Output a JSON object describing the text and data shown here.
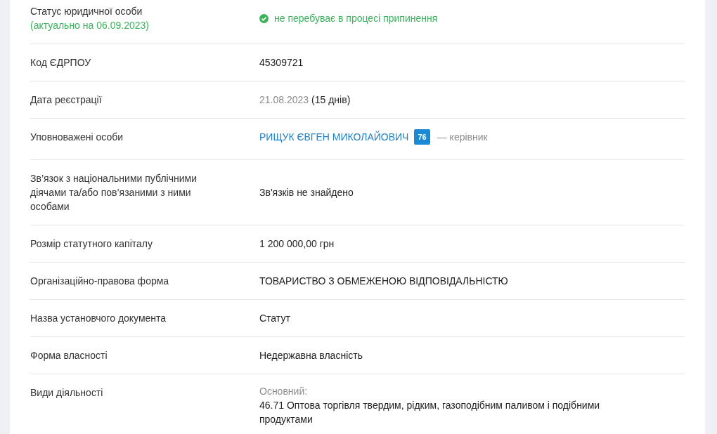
{
  "rows": [
    {
      "kind": "status",
      "label": "Статус юридичної особи",
      "note": "(актуально на 06.09.2023)",
      "value": "не перебуває в процесі припинення"
    },
    {
      "kind": "plain",
      "label": "Код ЄДРПОУ",
      "value": "45309721"
    },
    {
      "kind": "date",
      "label": "Дата реєстрації",
      "value": "21.08.2023",
      "suffix": "(15 днів)"
    },
    {
      "kind": "person",
      "label": "Уповноважені особи",
      "value": "РИЩУК ЄВГЕН МИКОЛАЙОВИЧ",
      "badge": "76",
      "role": "— керівник"
    },
    {
      "kind": "plain",
      "label": "Зв’язок з національними публічними діячами та/або пов’язаними з ними особами",
      "value": "Зв'язків не знайдено"
    },
    {
      "kind": "plain",
      "label": "Розмір статутного капіталу",
      "value": "1 200 000,00 грн"
    },
    {
      "kind": "plain",
      "label": "Організаційно-правова форма",
      "value": "ТОВАРИСТВО З ОБМЕЖЕНОЮ ВІДПОВІДАЛЬНІСТЮ"
    },
    {
      "kind": "plain",
      "label": "Назва установчого документа",
      "value": "Статут"
    },
    {
      "kind": "plain",
      "label": "Форма власності",
      "value": "Недержавна власність"
    },
    {
      "kind": "activity",
      "label": "Види діяльності",
      "caption": "Основний:",
      "value": "46.71 Оптова торгівля твердим, рідким, газоподібним паливом і подібними продуктами"
    }
  ]
}
